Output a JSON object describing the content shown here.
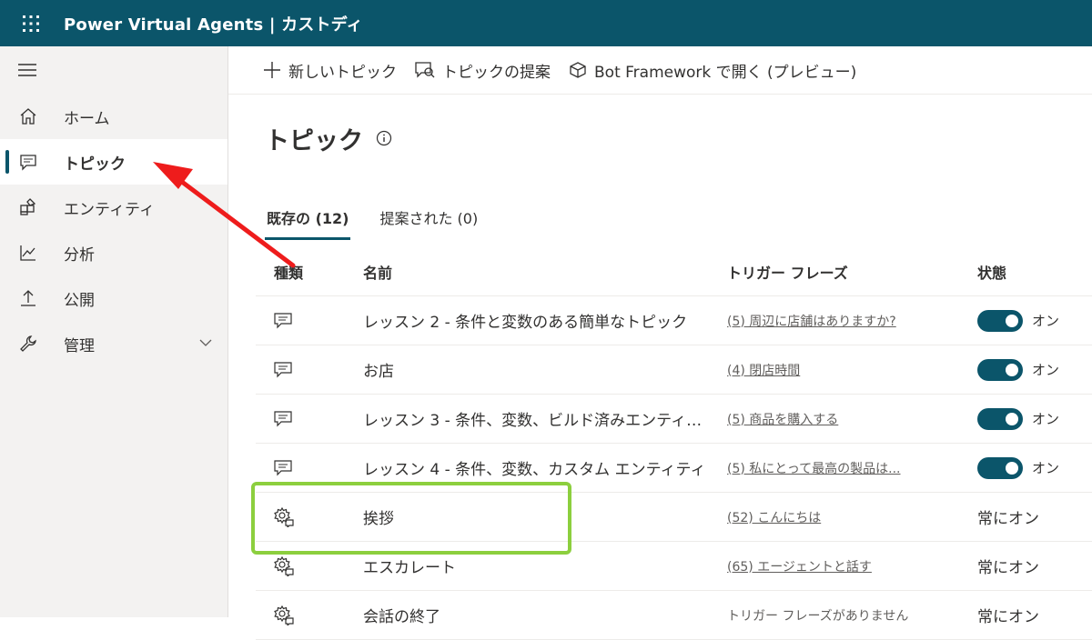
{
  "app": {
    "title": "Power Virtual Agents | カストディ"
  },
  "sidebar": {
    "items": [
      {
        "label": "ホーム",
        "icon": "home-icon"
      },
      {
        "label": "トピック",
        "icon": "chat-icon",
        "active": true
      },
      {
        "label": "エンティティ",
        "icon": "entity-icon"
      },
      {
        "label": "分析",
        "icon": "chart-icon"
      },
      {
        "label": "公開",
        "icon": "upload-icon"
      },
      {
        "label": "管理",
        "icon": "wrench-icon"
      }
    ]
  },
  "commands": {
    "new_topic": "新しいトピック",
    "suggest_topics": "トピックの提案",
    "open_bot_framework": "Bot Framework で開く (プレビュー)"
  },
  "page": {
    "title": "トピック"
  },
  "tabs": [
    {
      "label": "既存の (12)"
    },
    {
      "label": "提案された (0)"
    }
  ],
  "table": {
    "headers": {
      "type": "種類",
      "name": "名前",
      "trigger": "トリガー フレーズ",
      "status": "状態"
    },
    "rows": [
      {
        "name": "レッスン 2 - 条件と変数のある簡単なトピック",
        "trigger": "(5) 周辺に店舗はありますか?",
        "status": "オン"
      },
      {
        "name": "お店",
        "trigger": "(4) 閉店時間",
        "status": "オン"
      },
      {
        "name": "レッスン 3 - 条件、変数、ビルド済みエンティティ",
        "trigger": "(5) 商品を購入する",
        "status": "オン"
      },
      {
        "name": "レッスン 4 - 条件、変数、カスタム エンティティ",
        "trigger": "(5) 私にとって最高の製品は...",
        "status": "オン"
      },
      {
        "name": "挨拶",
        "trigger": "(52) こんにちは",
        "status": "常にオン"
      },
      {
        "name": "エスカレート",
        "trigger": "(65) エージェントと話す",
        "status": "常にオン"
      },
      {
        "name": "会話の終了",
        "trigger": "トリガー フレーズがありません",
        "status": "常にオン"
      }
    ]
  },
  "colors": {
    "brand": "#0b556a",
    "highlight": "#8ccf3e",
    "arrow": "#ee1c1c"
  }
}
